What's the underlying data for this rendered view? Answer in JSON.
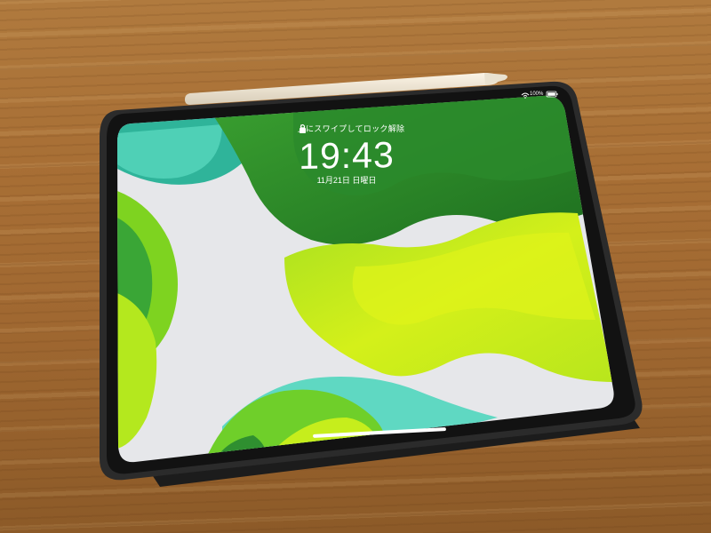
{
  "lock_screen": {
    "unlock_hint": "上にスワイプしてロック解除",
    "time": "19:43",
    "date": "11月21日 日曜日"
  },
  "status_bar": {
    "battery_percent": "100%",
    "battery_level": 1.0,
    "wifi": "wifi-icon"
  },
  "colors": {
    "wood": "#a86f35",
    "bezel": "#151515",
    "wallpaper_light": "#e8e8ea",
    "green_dark": "#2f8a2a",
    "green_mid": "#5cc41e",
    "lime": "#c8ee1c",
    "teal": "#5fd8c2"
  }
}
